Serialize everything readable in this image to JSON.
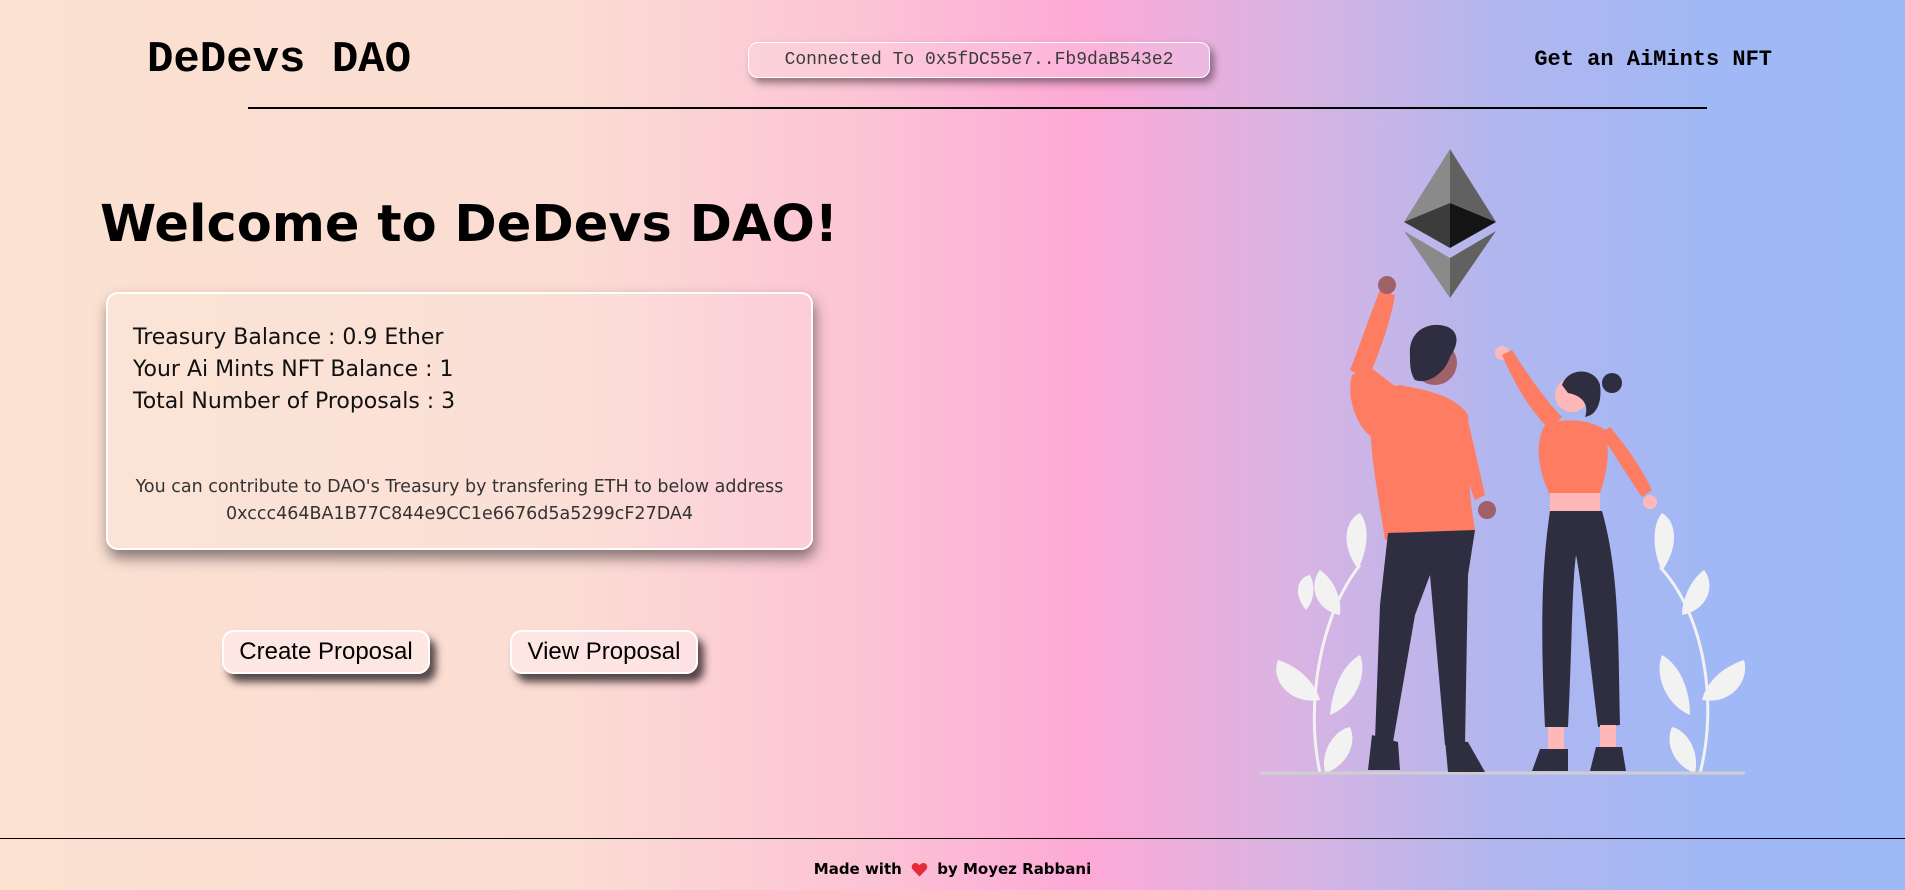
{
  "header": {
    "brand": "DeDevs DAO",
    "connected_text": "Connected To 0x5fDC55e7..Fb9daB543e2",
    "nft_link": "Get an AiMints NFT"
  },
  "main": {
    "welcome_title": "Welcome to DeDevs DAO!",
    "stats": {
      "treasury_balance": "Treasury Balance : 0.9 Ether",
      "nft_balance": "Your Ai Mints NFT Balance : 1",
      "total_proposals": "Total Number of Proposals : 3"
    },
    "contribute_text": "You can contribute to DAO's Treasury by transfering ETH to below address",
    "treasury_address": "0xccc464BA1B77C844e9CC1e6676d5a5299cF27DA4",
    "buttons": {
      "create_proposal": "Create Proposal",
      "view_proposal": "View Proposal"
    }
  },
  "footer": {
    "made_with": "Made with",
    "by": "by Moyez Rabbani",
    "heart_icon": "heart-icon"
  },
  "colors": {
    "gradient": [
      "#fbe2d1",
      "#fda9d6",
      "#9dbaf6"
    ],
    "heart": "#e8293a",
    "shirt": "#fd7c62",
    "pants": "#2f2e41",
    "ethereum_logo": "#343434"
  }
}
